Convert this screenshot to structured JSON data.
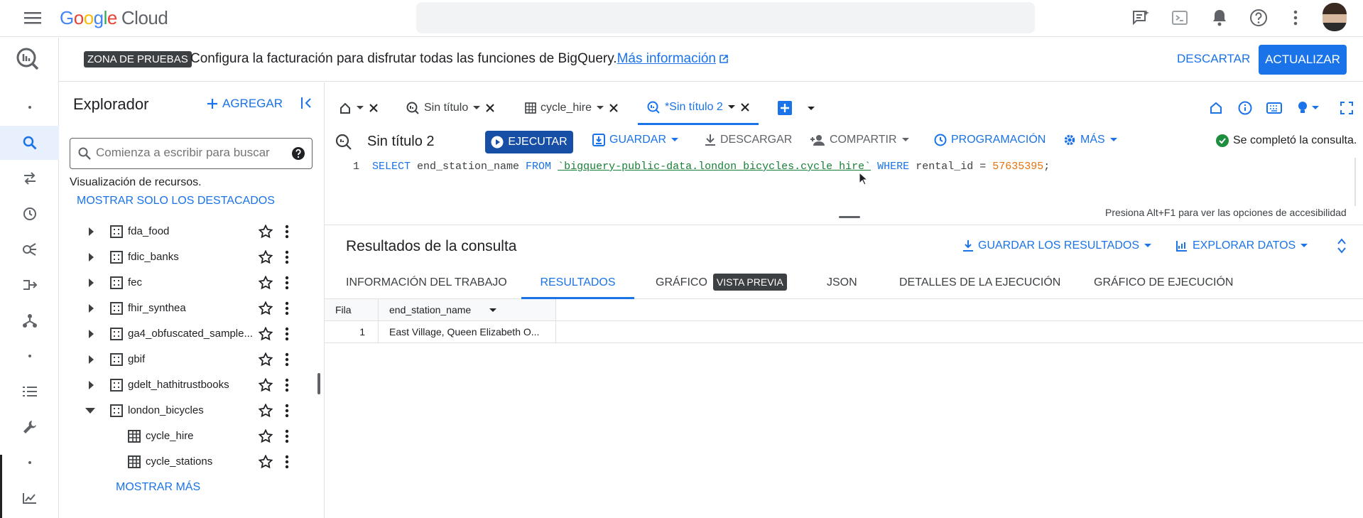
{
  "header": {
    "logo_google": [
      "G",
      "o",
      "o",
      "g",
      "l",
      "e"
    ],
    "logo_cloud": "Cloud"
  },
  "banner": {
    "badge": "ZONA DE PRUEBAS",
    "text": "Configura la facturación para disfrutar todas las funciones de BigQuery.",
    "link": "Más información",
    "dismiss": "DESCARTAR",
    "update": "ACTUALIZAR"
  },
  "explorer": {
    "title": "Explorador",
    "add": "AGREGAR",
    "search_placeholder": "Comienza a escribir para buscar",
    "resources_label": "Visualización de recursos.",
    "starred_link": "MOSTRAR SOLO LOS DESTACADOS",
    "items": [
      {
        "label": "fda_food"
      },
      {
        "label": "fdic_banks"
      },
      {
        "label": "fec"
      },
      {
        "label": "fhir_synthea"
      },
      {
        "label": "ga4_obfuscated_sample..."
      },
      {
        "label": "gbif"
      },
      {
        "label": "gdelt_hathitrustbooks"
      },
      {
        "label": "london_bicycles"
      },
      {
        "label": "cycle_hire"
      },
      {
        "label": "cycle_stations"
      }
    ],
    "show_more": "MOSTRAR MÁS"
  },
  "tabs": [
    {
      "label": "Sin título"
    },
    {
      "label": "cycle_hire"
    },
    {
      "label": "*Sin título 2"
    }
  ],
  "editor": {
    "title": "Sin título 2",
    "run": "EJECUTAR",
    "save": "GUARDAR",
    "download": "DESCARGAR",
    "share": "COMPARTIR",
    "schedule": "PROGRAMACIÓN",
    "more": "MÁS",
    "status": "Se completó la consulta.",
    "line_number": "1",
    "code": {
      "k1": "SELECT",
      "t1": " end_station_name ",
      "k2": "FROM",
      "s1": "`bigquery-public-data.london_bicycles.cycle_hire`",
      "k3": "WHERE",
      "t2": " rental_id = ",
      "n1": "57635395",
      "t3": ";"
    },
    "a11y_hint": "Presiona Alt+F1 para ver las opciones de accesibilidad"
  },
  "results": {
    "title": "Resultados de la consulta",
    "save_results": "GUARDAR LOS RESULTADOS",
    "explore": "EXPLORAR DATOS",
    "tabs": [
      "INFORMACIÓN DEL TRABAJO",
      "RESULTADOS",
      "GRÁFICO",
      "JSON",
      "DETALLES DE LA EJECUCIÓN",
      "GRÁFICO DE EJECUCIÓN"
    ],
    "preview_badge": "VISTA PREVIA",
    "columns": [
      "Fila",
      "end_station_name"
    ],
    "rows": [
      [
        "1",
        "East Village, Queen Elizabeth O..."
      ]
    ]
  },
  "colors": {
    "accent": "#1a73e8",
    "run_button": "#174ea6",
    "success": "#1e8e3e"
  }
}
